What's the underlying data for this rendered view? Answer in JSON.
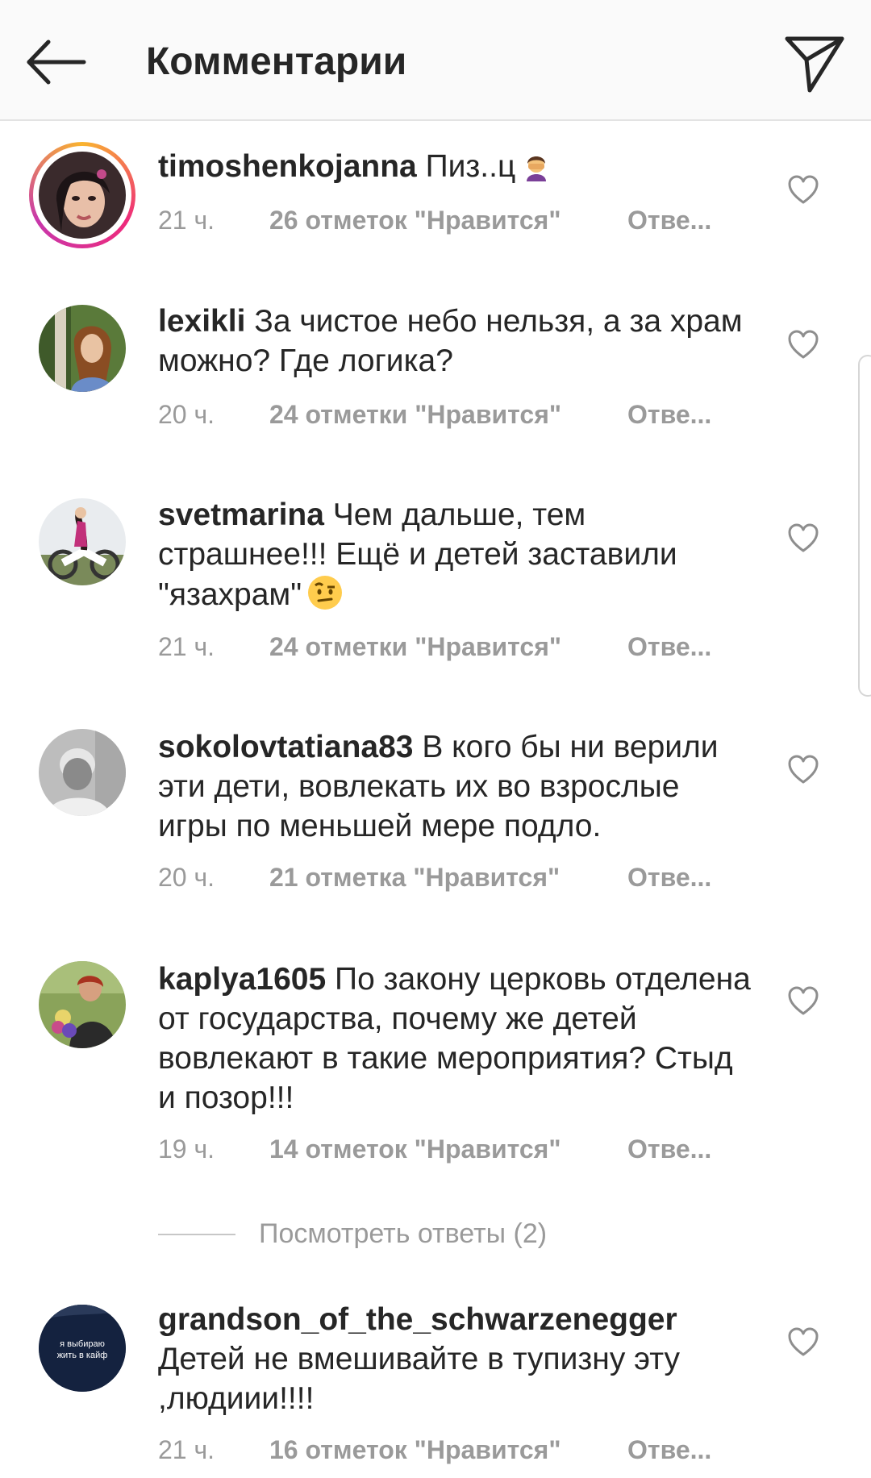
{
  "header": {
    "title": "Комментарии",
    "back_icon": "arrow-left-icon",
    "send_icon": "paper-plane-icon"
  },
  "comments": [
    {
      "username": "timoshenkojanna",
      "text": "Пиз..ц",
      "emoji": "face-palm-emoji",
      "time": "21 ч.",
      "likes": "26 отметок \"Нравится\"",
      "reply": "Отве...",
      "story_ring": true
    },
    {
      "username": "lexikli",
      "text": "За чистое небо нельзя, а за храм можно? Где логика?",
      "time": "20 ч.",
      "likes": "24 отметки \"Нравится\"",
      "reply": "Отве..."
    },
    {
      "username": "svetmarina",
      "text": "Чем дальше, тем страшнее!!! Ещё и детей заставили \"язахрам\"",
      "emoji": "raised-eyebrow-emoji",
      "time": "21 ч.",
      "likes": "24 отметки \"Нравится\"",
      "reply": "Отве..."
    },
    {
      "username": "sokolovtatiana83",
      "text": "В кого бы ни верили эти дети, вовлекать их во взрослые игры по меньшей мере подло.",
      "time": "20 ч.",
      "likes": "21 отметка \"Нравится\"",
      "reply": "Отве..."
    },
    {
      "username": "kaplya1605",
      "text": "По закону церковь отделена от государства, почему же детей вовлекают в такие мероприятия? Стыд и позор!!!",
      "time": "19 ч.",
      "likes": "14 отметок \"Нравится\"",
      "reply": "Отве..."
    },
    {
      "username": "grandson_of_the_schwarzenegger",
      "text": "Детей не вмешивайте в тупизну эту ,людиии!!!!",
      "time": "21 ч.",
      "likes": "16 отметок \"Нравится\"",
      "reply": "Отве...",
      "avatar_text": "я выбираю жить в кайф"
    }
  ],
  "view_replies": "Посмотреть ответы (2)",
  "colors": {
    "text": "#262626",
    "meta": "#9a9a9a",
    "header_bg": "#fafafa"
  }
}
